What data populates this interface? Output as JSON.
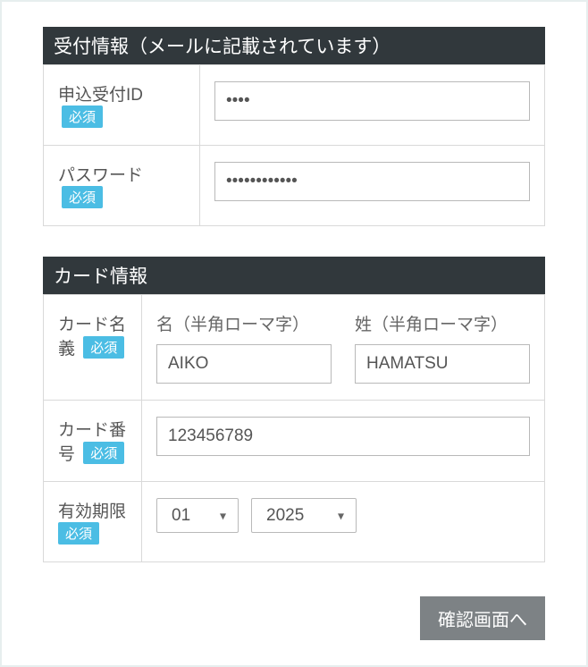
{
  "required_label": "必須",
  "reception": {
    "header": "受付情報（メールに記載されています）",
    "fields": {
      "id": {
        "label": "申込受付ID",
        "value": "abcd"
      },
      "password": {
        "label": "パスワード",
        "value": "abcdefghijkl"
      }
    }
  },
  "card": {
    "header": "カード情報",
    "fields": {
      "name": {
        "label": "カード名義",
        "first": {
          "heading": "名（半角ローマ字）",
          "value": "AIKO"
        },
        "last": {
          "heading": "姓（半角ローマ字）",
          "value": "HAMATSU"
        }
      },
      "number": {
        "label": "カード番号",
        "value": "123456789"
      },
      "expiry": {
        "label": "有効期限",
        "month": {
          "selected": "01"
        },
        "year": {
          "selected": "2025"
        }
      }
    }
  },
  "submit_label": "確認画面へ"
}
